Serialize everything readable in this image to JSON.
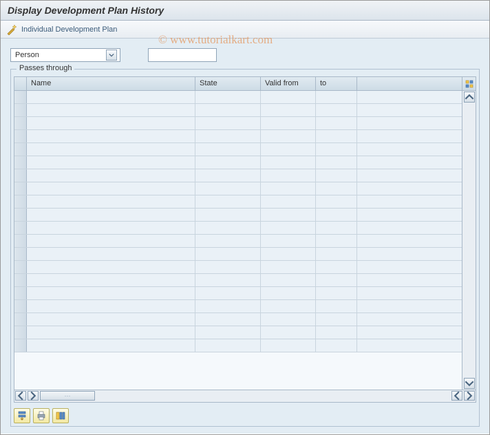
{
  "title": "Display Development Plan History",
  "toolbar": {
    "individual_plan_label": "Individual Development Plan"
  },
  "filter": {
    "dropdown": {
      "selected": "Person"
    },
    "search_value": ""
  },
  "group": {
    "label": "Passes through"
  },
  "table": {
    "columns": {
      "name": "Name",
      "state": "State",
      "valid_from": "Valid from",
      "to": "to"
    },
    "rows": [
      {},
      {},
      {},
      {},
      {},
      {},
      {},
      {},
      {},
      {},
      {},
      {},
      {},
      {},
      {},
      {},
      {},
      {},
      {},
      {}
    ]
  },
  "watermark": "© www.tutorialkart.com"
}
